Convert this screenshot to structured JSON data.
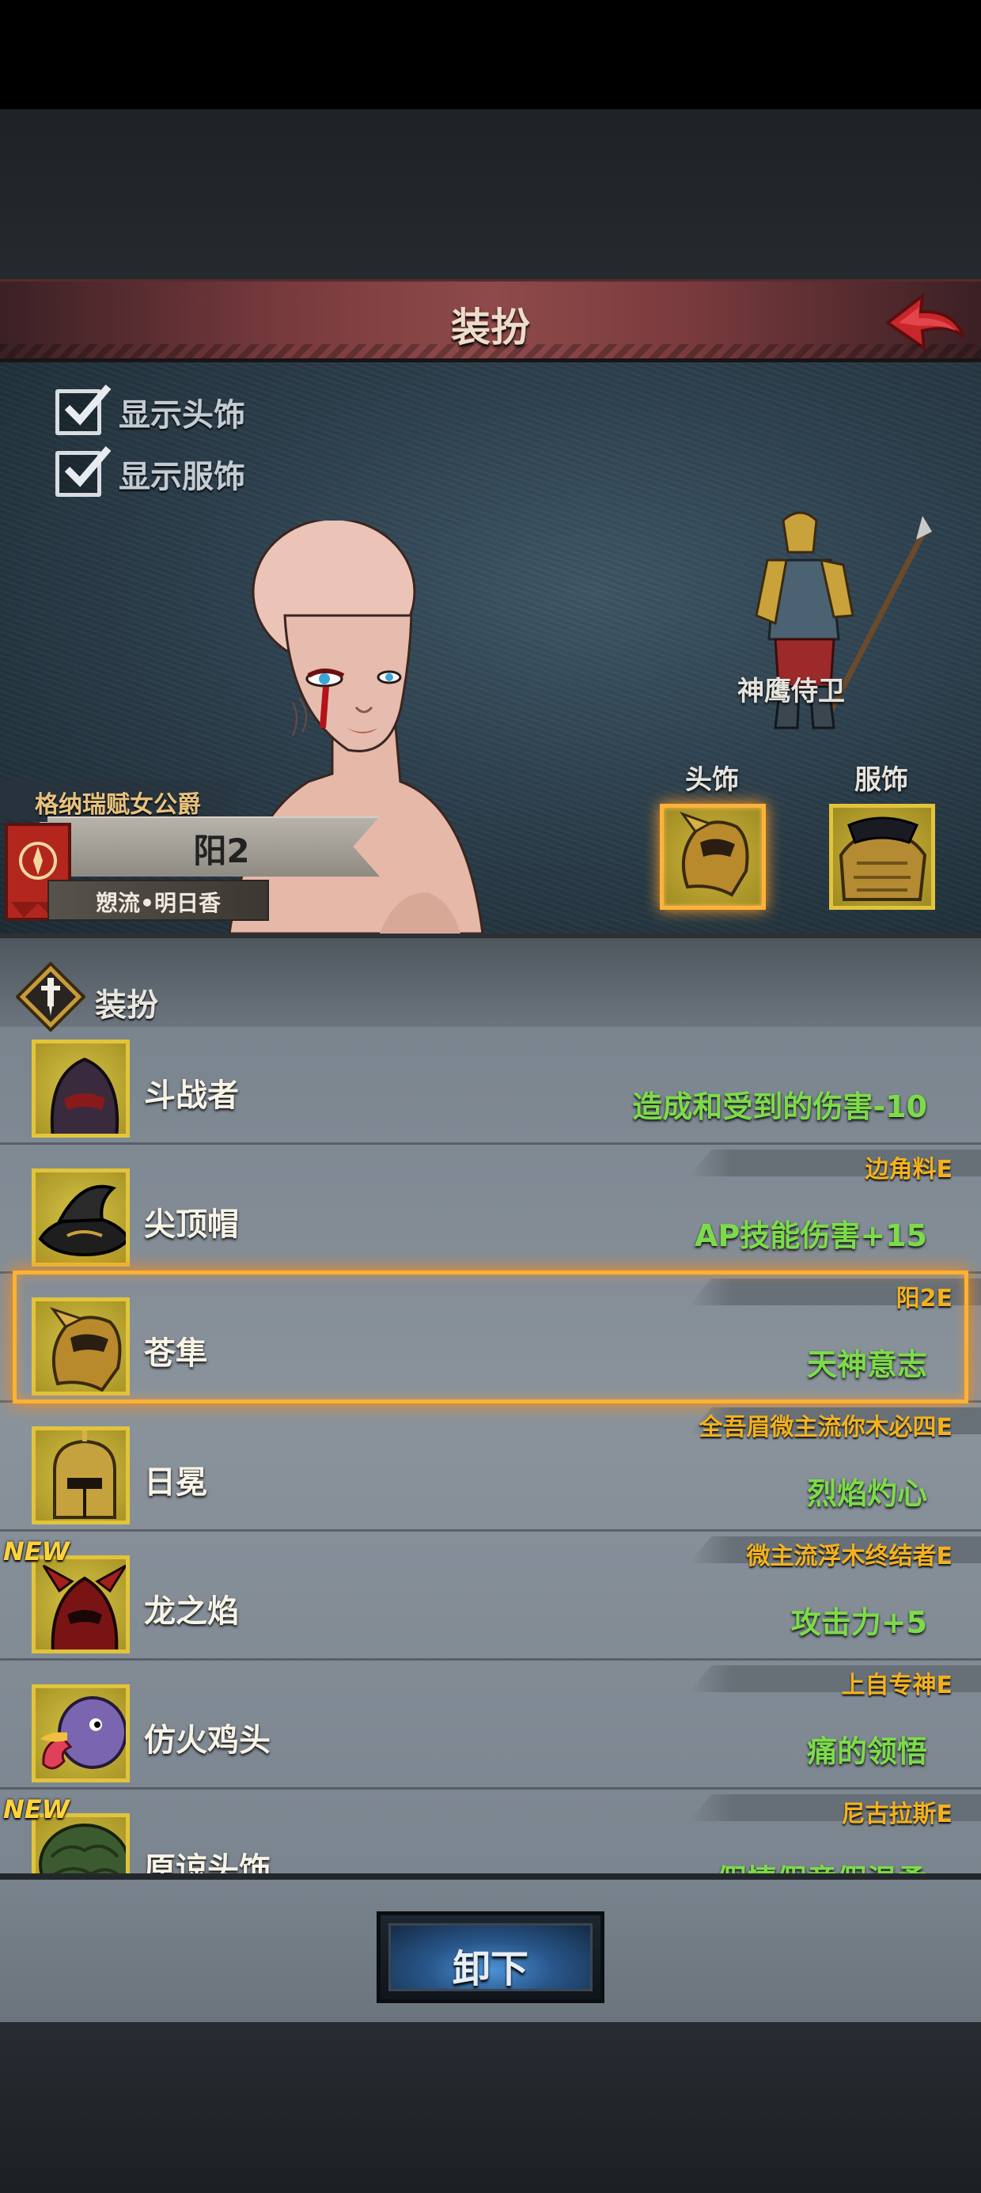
{
  "header": {
    "title": "装扮"
  },
  "options": [
    {
      "label": "显示头饰",
      "checked": true
    },
    {
      "label": "显示服饰",
      "checked": true
    }
  ],
  "preview": {
    "guard_name": "神鹰侍卫",
    "slot_head_label": "头饰",
    "slot_outfit_label": "服饰"
  },
  "character": {
    "title": "格纳瑞赋女公爵",
    "name": "阳2",
    "subname": "愬流•明日香"
  },
  "list": {
    "title": "装扮",
    "items": [
      {
        "name": "斗战者",
        "tag": "",
        "effect": "造成和受到的伤害-10",
        "is_new": false,
        "selected": false,
        "icon": "dark-helm-icon"
      },
      {
        "name": "尖顶帽",
        "tag": "边角料E",
        "effect": "AP技能伤害+15",
        "is_new": false,
        "selected": false,
        "icon": "pointed-hat-icon"
      },
      {
        "name": "苍隼",
        "tag": "阳2E",
        "effect": "天神意志",
        "is_new": false,
        "selected": true,
        "icon": "falcon-helm-icon"
      },
      {
        "name": "日冕",
        "tag": "全吾眉微主流你木必四E",
        "effect": "烈焰灼心",
        "is_new": false,
        "selected": false,
        "icon": "sun-helm-icon"
      },
      {
        "name": "龙之焰",
        "tag": "微主流浮木终结者E",
        "effect": "攻击力+5",
        "is_new": true,
        "selected": false,
        "icon": "dragon-helm-icon"
      },
      {
        "name": "仿火鸡头",
        "tag": "上自专神E",
        "effect": "痛的领悟",
        "is_new": false,
        "selected": false,
        "icon": "turkey-head-icon"
      },
      {
        "name": "原谅头饰",
        "tag": "尼古拉斯E",
        "effect": "假情假意假温柔",
        "is_new": true,
        "selected": false,
        "icon": "green-hat-icon"
      }
    ],
    "new_label": "NEW"
  },
  "footer": {
    "unequip_label": "卸下"
  },
  "colors": {
    "header": "#7a3b3e",
    "tag": "#f2b21f",
    "effect": "#7ddb4a",
    "slot_border": "#e2c43b",
    "selection": "#ffb22f",
    "button": "#4d93d6"
  }
}
